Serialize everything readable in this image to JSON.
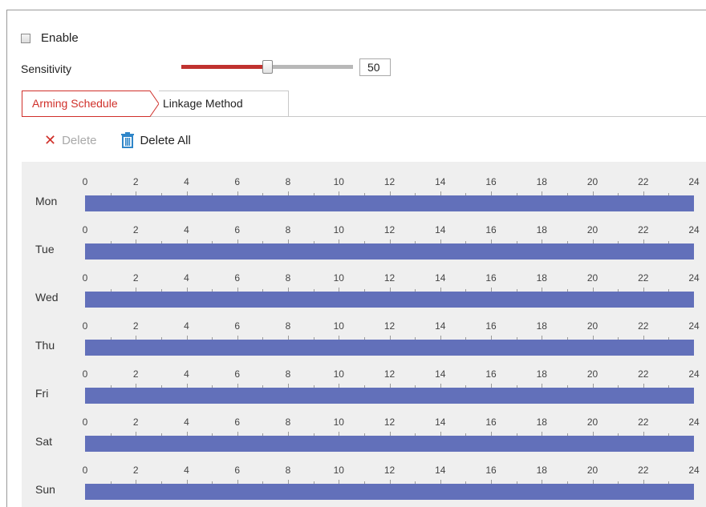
{
  "enable": {
    "label": "Enable",
    "checked": false
  },
  "sensitivity": {
    "label": "Sensitivity",
    "value": "50",
    "min": 0,
    "max": 100
  },
  "tabs": [
    {
      "label": "Arming Schedule",
      "active": true
    },
    {
      "label": "Linkage Method",
      "active": false
    }
  ],
  "toolbar": {
    "delete_label": "Delete",
    "delete_icon": "close-icon",
    "delete_all_label": "Delete All",
    "delete_all_icon": "trash-icon"
  },
  "schedule": {
    "hour_labels": [
      "0",
      "2",
      "4",
      "6",
      "8",
      "10",
      "12",
      "14",
      "16",
      "18",
      "20",
      "22",
      "24"
    ],
    "days": [
      {
        "label": "Mon",
        "segments": [
          [
            0,
            24
          ]
        ]
      },
      {
        "label": "Tue",
        "segments": [
          [
            0,
            24
          ]
        ]
      },
      {
        "label": "Wed",
        "segments": [
          [
            0,
            24
          ]
        ]
      },
      {
        "label": "Thu",
        "segments": [
          [
            0,
            24
          ]
        ]
      },
      {
        "label": "Fri",
        "segments": [
          [
            0,
            24
          ]
        ]
      },
      {
        "label": "Sat",
        "segments": [
          [
            0,
            24
          ]
        ]
      },
      {
        "label": "Sun",
        "segments": [
          [
            0,
            24
          ]
        ]
      }
    ]
  },
  "colors": {
    "accent": "#d0302a",
    "bar": "#6270ba",
    "slider_fill": "#c0322f",
    "panel_bg": "#efefef"
  }
}
